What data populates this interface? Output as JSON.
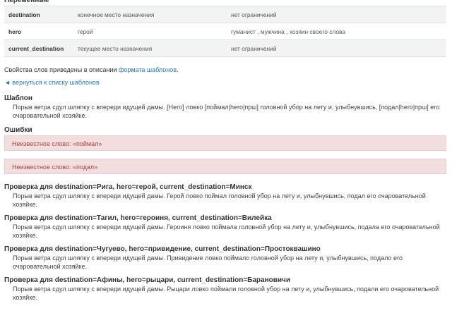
{
  "variables": {
    "title": "Переменные",
    "rows": [
      {
        "name": "destination",
        "description": "конечное место назначения",
        "restrictions": "нет ограничений"
      },
      {
        "name": "hero",
        "description": "герой",
        "restrictions": "гуманист , мужчина , хозяин своего слова"
      },
      {
        "name": "current_destination",
        "description": "текущее место назначения",
        "restrictions": "нет ограничений"
      }
    ]
  },
  "properties_note": {
    "prefix": "Свойства слов приведены в описании ",
    "link": "формата шаблонов",
    "suffix": "."
  },
  "back_link": "◄ вернуться к списку шаблонов",
  "template": {
    "title": "Шаблон",
    "text": "Порыв ветра сдул шляпку с впереди идущей дамы. [Hero] ловко [поймал|hero|прш] головной убор на лету и, улыбнувшись, [подал|hero|прш] его очаровательной хозяйке."
  },
  "errors": {
    "title": "Ошибки",
    "items": [
      "Неизвестное слово: «поймал»",
      "Неизвестное слово: «подал»"
    ]
  },
  "checks": [
    {
      "title": "Проверка для destination=Рига, hero=герой, current_destination=Минск",
      "text": "Порыв ветра сдул шляпку с впереди идущей дамы. Герой ловко поймал головной убор на лету и, улыбнувшись, подал его очаровательной хозяйке."
    },
    {
      "title": "Проверка для destination=Тагил, hero=героиня, current_destination=Вилейка",
      "text": "Порыв ветра сдул шляпку с впереди идущей дамы. Героиня ловко поймала головной убор на лету и, улыбнувшись, подала его очаровательной хозяйке."
    },
    {
      "title": "Проверка для destination=Чугуево, hero=привидение, current_destination=Простоквашино",
      "text": "Порыв ветра сдул шляпку с впереди идущей дамы. Привидение ловко поймало головной убор на лету и, улыбнувшись, подало его очаровательной хозяйке."
    },
    {
      "title": "Проверка для destination=Афины, hero=рыцари, current_destination=Барановичи",
      "text": "Порыв ветра сдул шляпку с впереди идущей дамы. Рыцари ловко поймали головной убор на лету и, улыбнувшись, подали его очаровательной хозяйке."
    }
  ]
}
